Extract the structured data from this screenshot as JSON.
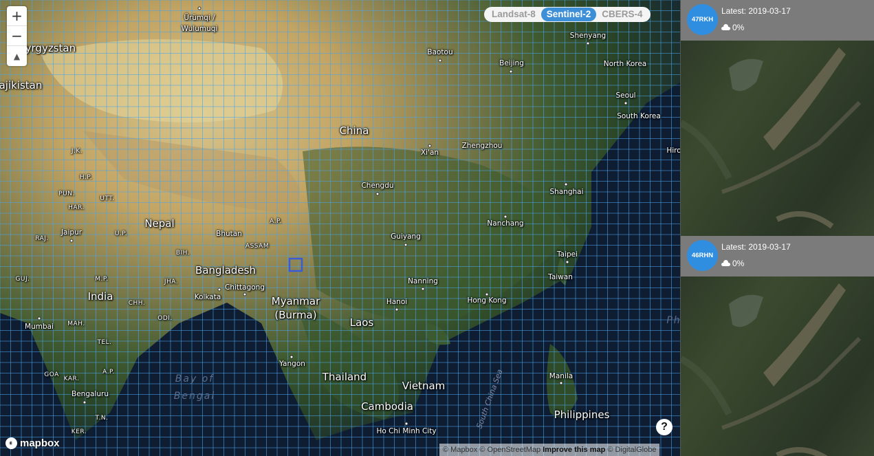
{
  "map": {
    "zoom": {
      "in_label": "+",
      "out_label": "−",
      "compass_label": "▲"
    },
    "satellite_toggle": {
      "options": [
        "Landsat-8",
        "Sentinel-2",
        "CBERS-4"
      ],
      "selected": "Sentinel-2"
    },
    "labels": {
      "countries": [
        "Kyrgyzstan",
        "ajikistan",
        "China",
        "Nepal",
        "Bangladesh",
        "India",
        "Myanmar",
        "(Burma)",
        "Laos",
        "Thailand",
        "Vietnam",
        "Cambodia",
        "Philippines",
        "North Korea",
        "South Korea",
        "Taiwan",
        "Bhutan"
      ],
      "cities": [
        "Ürümqi /",
        "Wulumuqi",
        "Baotou",
        "Beijing",
        "Shenyang",
        "Seoul",
        "Xi'an",
        "Zhengzhou",
        "Chengdu",
        "Shanghai",
        "Nanchang",
        "Guiyang",
        "Taipei",
        "Nanning",
        "Hanoi",
        "Hong Kong",
        "Kolkata",
        "Chittagong",
        "Jaipur",
        "Mumbai",
        "Bengaluru",
        "Yangon",
        "Manila",
        "Ho Chi Minh City",
        "Hiro"
      ],
      "regions": [
        "J.K.",
        "H.P.",
        "PUN.",
        "UTT.",
        "HAR.",
        "RAJ.",
        "U.P.",
        "BIH.",
        "A.P.",
        "ASSAM",
        "M.P.",
        "JHA.",
        "GUJ.",
        "CHH.",
        "ODI.",
        "MAH.",
        "TEL.",
        "GOA",
        "KAR.",
        "A.P.",
        "T.N.",
        "KER."
      ],
      "seas": [
        "Bay of",
        "Bengal",
        "South China Sea",
        "Ph"
      ]
    },
    "help_label": "?",
    "logo_text": "mapbox",
    "attribution": {
      "mapbox": "© Mapbox",
      "osm": "© OpenStreetMap",
      "improve": "Improve this map",
      "digitalglobe": "© DigitalGlobe"
    },
    "colors": {
      "grid": "#4aa3e8",
      "selected_tile": "#3b5bd6"
    }
  },
  "results": {
    "scenes": [
      {
        "tile_id": "47RKH",
        "date_label": "Latest: 2019-03-17",
        "cloud_label": "0%"
      },
      {
        "tile_id": "46RHN",
        "date_label": "Latest: 2019-03-17",
        "cloud_label": "0%"
      }
    ]
  }
}
